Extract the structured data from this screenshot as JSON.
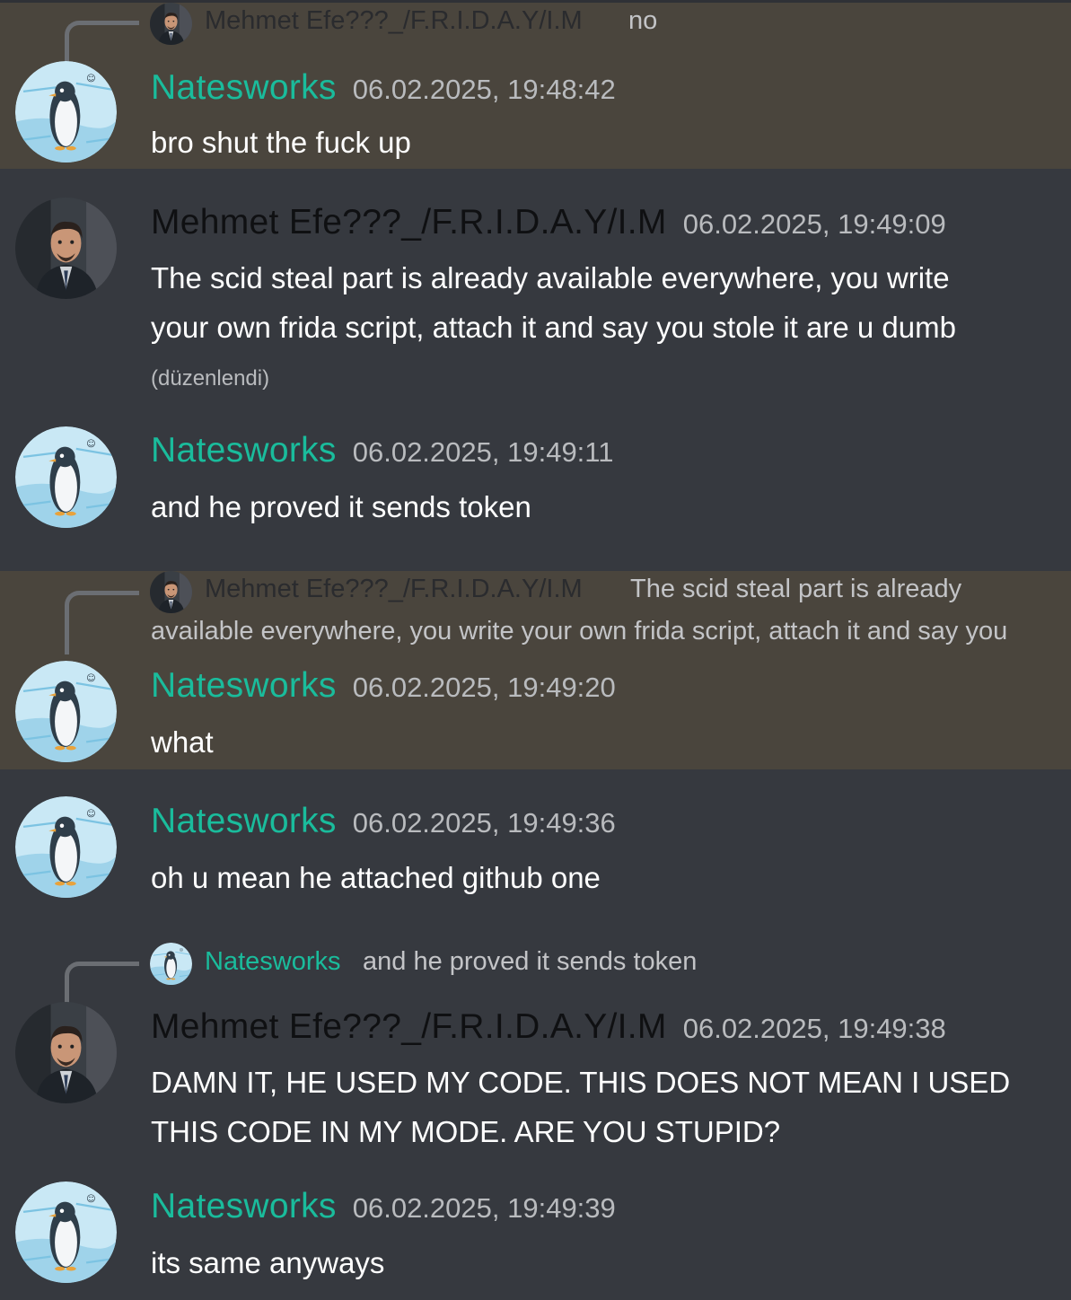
{
  "messages": [
    {
      "id": "m1",
      "author": "Natesworks",
      "timestamp": "06.02.2025, 19:48:42",
      "content": "bro shut the fuck up",
      "highlighted": true,
      "reply_to": {
        "author": "Mehmet Efe???_/F.R.I.D.A.Y/I.M",
        "snippet": "no"
      }
    },
    {
      "id": "m2",
      "author": "Mehmet Efe???_/F.R.I.D.A.Y/I.M",
      "timestamp": "06.02.2025, 19:49:09",
      "content_lines": [
        "The scid steal part is already available everywhere, you write",
        "your own frida script, attach it and say you stole it are u dumb"
      ],
      "edited_label": "(düzenlendi)"
    },
    {
      "id": "m3",
      "author": "Natesworks",
      "timestamp": "06.02.2025, 19:49:11",
      "content": "and he proved it sends token"
    },
    {
      "id": "m4",
      "author": "Natesworks",
      "timestamp": "06.02.2025, 19:49:20",
      "content": "what",
      "highlighted": true,
      "reply_to": {
        "author": "Mehmet Efe???_/F.R.I.D.A.Y/I.M",
        "snippet_line1": "The scid steal part is already",
        "snippet_line2": "available everywhere, you write your own frida script, attach it and say you"
      }
    },
    {
      "id": "m5",
      "author": "Natesworks",
      "timestamp": "06.02.2025, 19:49:36",
      "content": "oh u mean he attached github one"
    },
    {
      "id": "m6",
      "author": "Mehmet Efe???_/F.R.I.D.A.Y/I.M",
      "timestamp": "06.02.2025, 19:49:38",
      "content_lines": [
        "DAMN IT, HE USED MY CODE. THIS DOES NOT MEAN I USED",
        "THIS CODE IN MY MODE. ARE YOU STUPID?"
      ],
      "reply_to": {
        "author": "Natesworks",
        "snippet": "and he proved it sends token"
      }
    },
    {
      "id": "m7",
      "author": "Natesworks",
      "timestamp": "06.02.2025, 19:49:39",
      "content": "its same anyways"
    }
  ],
  "colors": {
    "background": "#36393f",
    "highlight": "#4a453d",
    "username_green": "#1abc9c",
    "username_dark": "#0f1012",
    "timestamp": "#b9bbbe"
  },
  "icons": {
    "penguin_avatar": "penguin-avatar-icon",
    "man_avatar": "man-portrait-avatar-icon"
  }
}
